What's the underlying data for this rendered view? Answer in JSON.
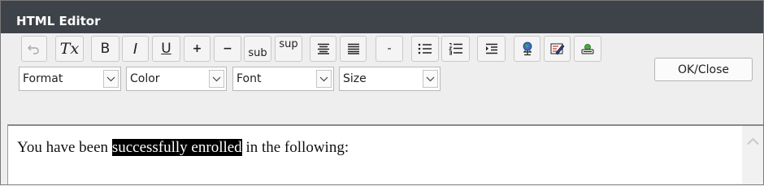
{
  "window": {
    "title": "HTML Editor"
  },
  "toolbar": {
    "buttons": {
      "undo": "",
      "clear_format": "Tx",
      "bold": "B",
      "italic": "I",
      "underline": "U",
      "add": "+",
      "remove": "−",
      "sub": "sub",
      "sup": "sup",
      "hr": "-"
    },
    "selects": {
      "format": "Format",
      "color": "Color",
      "font": "Font",
      "size": "Size"
    },
    "ok_close": "OK/Close"
  },
  "content": {
    "before": "You have been ",
    "highlighted": "successfully enrolled",
    "after": " in the following:"
  }
}
